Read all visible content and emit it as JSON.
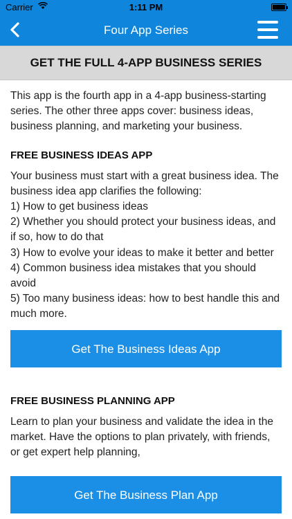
{
  "status_bar": {
    "carrier": "Carrier",
    "time": "1:11 PM"
  },
  "nav": {
    "title": "Four App Series",
    "back_icon": "chevron-left-icon",
    "menu_icon": "hamburger-menu-icon"
  },
  "banner": {
    "title": "GET THE FULL 4-APP BUSINESS SERIES"
  },
  "intro": {
    "text": "This app is the fourth app in a 4-app business-starting series. The other three apps cover: business ideas, business planning, and marketing your business."
  },
  "section_ideas": {
    "heading": "FREE BUSINESS IDEAS APP",
    "lines": [
      "Your business must start with a great business idea. The business idea app clarifies the following:",
      "1) How to get business ideas",
      "2) Whether you should protect your business ideas, and if so, how to do that",
      "3) How to evolve your ideas to make it better and better",
      "4) Common business idea mistakes that you should avoid",
      "5) Too many business ideas: how to best handle this and much more."
    ],
    "button_label": "Get The Business Ideas App"
  },
  "section_planning": {
    "heading": "FREE BUSINESS PLANNING APP",
    "text": "Learn to plan your business and validate the idea in the market. Have the options to plan privately, with friends, or get expert help planning,",
    "button_label": "Get The Business Plan App"
  },
  "colors": {
    "nav_bar": "#0f86dc",
    "button": "#1b8fe6",
    "banner": "#d8d8d8"
  }
}
